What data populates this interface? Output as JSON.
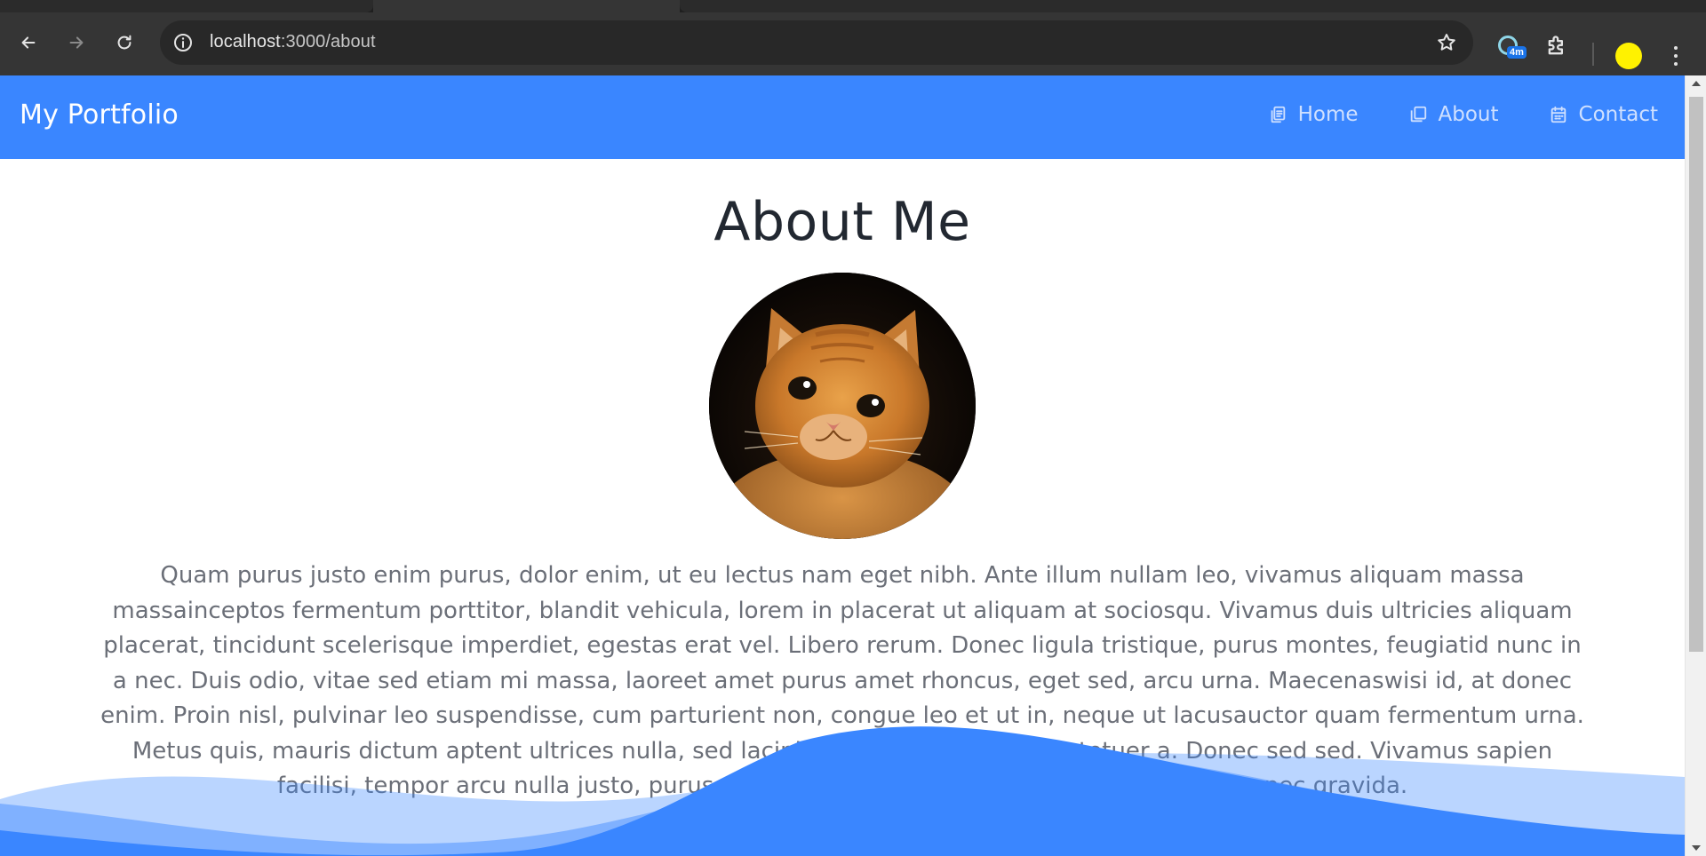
{
  "browser": {
    "url_host": "localhost",
    "url_path": ":3000/about",
    "extension_badge": "4m",
    "icons": {
      "back": "back-arrow-icon",
      "forward": "forward-arrow-icon",
      "reload": "reload-icon",
      "site_info": "site-info-icon",
      "bookmark": "star-icon",
      "extension": "globe-extension-icon",
      "extensions_menu": "puzzle-icon",
      "menu": "kebab-menu-icon"
    },
    "profile_color": "#fff200"
  },
  "site": {
    "brand": "My Portfolio",
    "nav_color": "#3a86ff",
    "nav": [
      {
        "label": "Home",
        "icon": "copy-pages-icon"
      },
      {
        "label": "About",
        "icon": "copy-pages-icon"
      },
      {
        "label": "Contact",
        "icon": "calendar-icon"
      }
    ]
  },
  "about": {
    "heading": "About Me",
    "avatar": "kitten-photo",
    "text": "Quam purus justo enim purus, dolor enim, ut eu lectus nam eget nibh. Ante illum nullam leo, vivamus aliquam massa massainceptos fermentum porttitor, blandit vehicula, lorem in placerat ut aliquam at sociosqu. Vivamus duis ultricies aliquam placerat, tincidunt scelerisque imperdiet, egestas erat vel. Libero rerum. Donec ligula tristique, purus montes, feugiatid nunc in a nec. Duis odio, vitae sed etiam mi massa, laoreet amet purus amet rhoncus, eget sed, arcu urna. Maecenaswisi id, at donec enim. Proin nisl, pulvinar leo suspendisse, cum parturient non, congue leo et ut in, neque ut lacusauctor quam fermentum urna. Metus quis, mauris dictum aptent ultrices nulla, sed lacinia urna, et ipsum consectetuer a. Donec sed sed. Vivamus sapien facilisi, tempor arcu nulla justo, purus vitae lobortis, in praesent fermentum turpis, a nec gravida."
  }
}
